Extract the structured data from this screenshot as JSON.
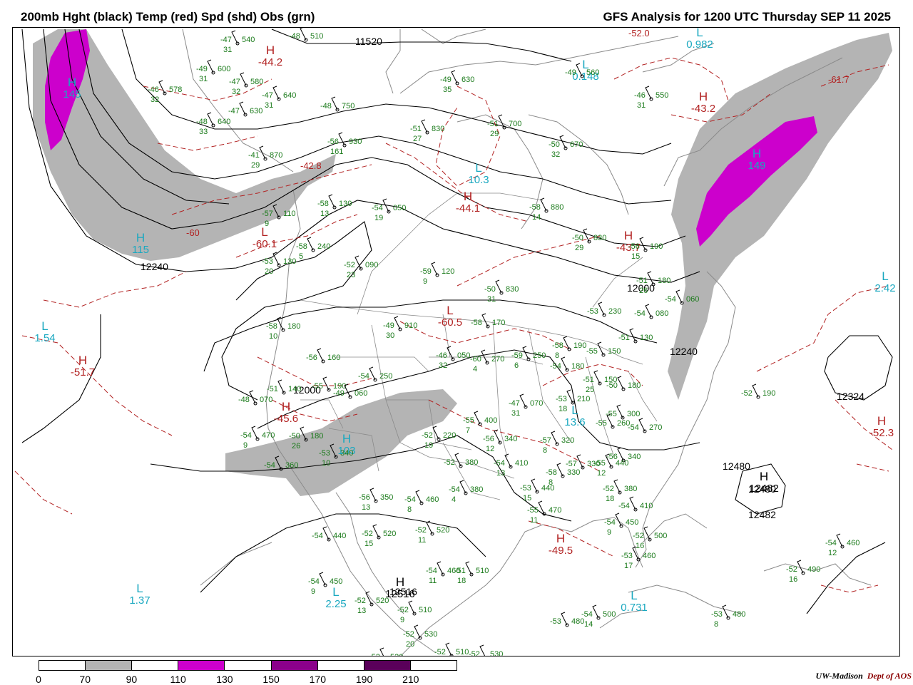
{
  "header": {
    "title_left": "200mb Hght (black) Temp (red) Spd (shd) Obs (grn)",
    "title_right": "GFS Analysis for 1200 UTC Thursday  SEP 11 2025"
  },
  "colors": {
    "height": "#000000",
    "temp": "#b22222",
    "obs": "#1a7a1a",
    "low_high": "#1aa8c0",
    "shade_70_90": "#b4b4b4",
    "shade_110_130": "#cc00cc",
    "shade_150_170": "#8b008b",
    "shade_190_210": "#5a005a"
  },
  "colorbar": {
    "labels": [
      "0",
      "70",
      "90",
      "110",
      "130",
      "150",
      "170",
      "190",
      "210"
    ],
    "segments": [
      "#ffffff",
      "#b4b4b4",
      "#ffffff",
      "#cc00cc",
      "#ffffff",
      "#8b008b",
      "#ffffff",
      "#5a005a",
      "#ffffff"
    ]
  },
  "credit": {
    "org": "UW-Madison",
    "dept": "Dept of AOS"
  },
  "height_labels": [
    "11520",
    "12240",
    "12000",
    "12240",
    "12324",
    "12480",
    "12482",
    "12480",
    "12516",
    "12000"
  ],
  "centers": [
    {
      "type": "H",
      "value": "145",
      "color": "cyan"
    },
    {
      "type": "H",
      "value": "149",
      "color": "cyan"
    },
    {
      "type": "H",
      "value": "115",
      "color": "cyan"
    },
    {
      "type": "H",
      "value": "103",
      "color": "cyan"
    },
    {
      "type": "L",
      "value": "10.3",
      "color": "cyan"
    },
    {
      "type": "L",
      "value": "0.148",
      "color": "cyan"
    },
    {
      "type": "L",
      "value": "1.54",
      "color": "cyan"
    },
    {
      "type": "L",
      "value": "2.42",
      "color": "cyan"
    },
    {
      "type": "L",
      "value": "13.6",
      "color": "cyan"
    },
    {
      "type": "L",
      "value": "1.37",
      "color": "cyan"
    },
    {
      "type": "L",
      "value": "2.25",
      "color": "cyan"
    },
    {
      "type": "L",
      "value": "0.731",
      "color": "cyan"
    },
    {
      "type": "L",
      "value": "0.982",
      "color": "cyan"
    },
    {
      "type": "H",
      "value": "-44.2",
      "color": "red"
    },
    {
      "type": "H",
      "value": "-43.2",
      "color": "red"
    },
    {
      "type": "H",
      "value": "-44.1",
      "color": "red"
    },
    {
      "type": "H",
      "value": "-43.7",
      "color": "red"
    },
    {
      "type": "H",
      "value": "-51.7",
      "color": "red"
    },
    {
      "type": "H",
      "value": "-45.6",
      "color": "red"
    },
    {
      "type": "H",
      "value": "-49.5",
      "color": "red"
    },
    {
      "type": "H",
      "value": "-52.3",
      "color": "red"
    },
    {
      "type": "L",
      "value": "-60.1",
      "color": "red"
    },
    {
      "type": "L",
      "value": "-60.5",
      "color": "red"
    },
    {
      "type": "H",
      "value": "12482",
      "color": "black"
    },
    {
      "type": "H",
      "value": "12516",
      "color": "black"
    }
  ],
  "temp_labels": [
    "-52.0",
    "-61.7",
    "-60",
    "-42.8"
  ],
  "obs": [
    {
      "t": "-47",
      "d": "31",
      "h": "540"
    },
    {
      "t": "-48",
      "d": "",
      "h": "510"
    },
    {
      "t": "-49",
      "d": "31",
      "h": "600"
    },
    {
      "t": "-47",
      "d": "32",
      "h": "580"
    },
    {
      "t": "-46",
      "d": "32",
      "h": "578"
    },
    {
      "t": "-47",
      "d": "31",
      "h": "640"
    },
    {
      "t": "-47",
      "d": "",
      "h": "630"
    },
    {
      "t": "-48",
      "d": "33",
      "h": "640"
    },
    {
      "t": "-48",
      "d": "",
      "h": "750"
    },
    {
      "t": "-49",
      "d": "35",
      "h": "630"
    },
    {
      "t": "-49",
      "d": "",
      "h": "560"
    },
    {
      "t": "-46",
      "d": "31",
      "h": "550"
    },
    {
      "t": "-51",
      "d": "27",
      "h": "830"
    },
    {
      "t": "-51",
      "d": "29",
      "h": "700"
    },
    {
      "t": "-50",
      "d": "32",
      "h": "670"
    },
    {
      "t": "-56",
      "d": "161",
      "h": "930"
    },
    {
      "t": "-41",
      "d": "29",
      "h": "870"
    },
    {
      "t": "-57",
      "d": "9",
      "h": "110"
    },
    {
      "t": "-58",
      "d": "13",
      "h": "130"
    },
    {
      "t": "-54",
      "d": "19",
      "h": "050"
    },
    {
      "t": "-58",
      "d": "14",
      "h": "880"
    },
    {
      "t": "-50",
      "d": "29",
      "h": "830"
    },
    {
      "t": "-56",
      "d": "15",
      "h": "190"
    },
    {
      "t": "-53",
      "d": "20",
      "h": "130"
    },
    {
      "t": "-58",
      "d": "5",
      "h": "240"
    },
    {
      "t": "-52",
      "d": "23",
      "h": "090"
    },
    {
      "t": "-59",
      "d": "9",
      "h": "120"
    },
    {
      "t": "-50",
      "d": "31",
      "h": "830"
    },
    {
      "t": "-49",
      "d": "30",
      "h": "910"
    },
    {
      "t": "-58",
      "d": "",
      "h": "170"
    },
    {
      "t": "-58",
      "d": "10",
      "h": "180"
    },
    {
      "t": "-51",
      "d": "26",
      "h": "180"
    },
    {
      "t": "-54",
      "d": "",
      "h": "060"
    },
    {
      "t": "-53",
      "d": "",
      "h": "230"
    },
    {
      "t": "-54",
      "d": "",
      "h": "080"
    },
    {
      "t": "-56",
      "d": "",
      "h": "160"
    },
    {
      "t": "-46",
      "d": "32",
      "h": "050"
    },
    {
      "t": "-60",
      "d": "4",
      "h": "270"
    },
    {
      "t": "-59",
      "d": "6",
      "h": "250"
    },
    {
      "t": "-58",
      "d": "8",
      "h": "190"
    },
    {
      "t": "-55",
      "d": "",
      "h": "150"
    },
    {
      "t": "-51",
      "d": "",
      "h": "130"
    },
    {
      "t": "-54",
      "d": "",
      "h": "180"
    },
    {
      "t": "-51",
      "d": "25",
      "h": "150"
    },
    {
      "t": "-50",
      "d": "",
      "h": "180"
    },
    {
      "t": "-54",
      "d": "",
      "h": "250"
    },
    {
      "t": "-55",
      "d": "",
      "h": "190"
    },
    {
      "t": "-49",
      "d": "",
      "h": "060"
    },
    {
      "t": "-51",
      "d": "",
      "h": "140"
    },
    {
      "t": "-48",
      "d": "",
      "h": "070"
    },
    {
      "t": "-47",
      "d": "31",
      "h": "070"
    },
    {
      "t": "-53",
      "d": "18",
      "h": "210"
    },
    {
      "t": "-52",
      "d": "",
      "h": "190"
    },
    {
      "t": "-54",
      "d": "9",
      "h": "470"
    },
    {
      "t": "-50",
      "d": "26",
      "h": "180"
    },
    {
      "t": "-52",
      "d": "19",
      "h": "220"
    },
    {
      "t": "-55",
      "d": "7",
      "h": "400"
    },
    {
      "t": "-56",
      "d": "12",
      "h": "340"
    },
    {
      "t": "-57",
      "d": "8",
      "h": "320"
    },
    {
      "t": "-55",
      "d": "",
      "h": "260"
    },
    {
      "t": "-55",
      "d": "",
      "h": "300"
    },
    {
      "t": "-54",
      "d": "",
      "h": "270"
    },
    {
      "t": "-54",
      "d": "",
      "h": "360"
    },
    {
      "t": "-53",
      "d": "10",
      "h": "340"
    },
    {
      "t": "-52",
      "d": "",
      "h": "380"
    },
    {
      "t": "-54",
      "d": "13",
      "h": "410"
    },
    {
      "t": "-58",
      "d": "8",
      "h": "330"
    },
    {
      "t": "-57",
      "d": "",
      "h": "330"
    },
    {
      "t": "-56",
      "d": "",
      "h": "340"
    },
    {
      "t": "-54",
      "d": "4",
      "h": "380"
    },
    {
      "t": "-53",
      "d": "15",
      "h": "440"
    },
    {
      "t": "-56",
      "d": "13",
      "h": "350"
    },
    {
      "t": "-54",
      "d": "8",
      "h": "460"
    },
    {
      "t": "-55",
      "d": "11",
      "h": "470"
    },
    {
      "t": "-52",
      "d": "18",
      "h": "380"
    },
    {
      "t": "-54",
      "d": "",
      "h": "410"
    },
    {
      "t": "-54",
      "d": "9",
      "h": "450"
    },
    {
      "t": "-54",
      "d": "",
      "h": "440"
    },
    {
      "t": "-52",
      "d": "15",
      "h": "520"
    },
    {
      "t": "-52",
      "d": "11",
      "h": "520"
    },
    {
      "t": "-52",
      "d": "16",
      "h": "500"
    },
    {
      "t": "-53",
      "d": "17",
      "h": "460"
    },
    {
      "t": "-54",
      "d": "12",
      "h": "460"
    },
    {
      "t": "-54",
      "d": "11",
      "h": "460"
    },
    {
      "t": "-51",
      "d": "18",
      "h": "510"
    },
    {
      "t": "-52",
      "d": "16",
      "h": "490"
    },
    {
      "t": "-54",
      "d": "9",
      "h": "450"
    },
    {
      "t": "-52",
      "d": "13",
      "h": "520"
    },
    {
      "t": "-52",
      "d": "9",
      "h": "510"
    },
    {
      "t": "-52",
      "d": "20",
      "h": "530"
    },
    {
      "t": "-52",
      "d": "11",
      "h": "520"
    },
    {
      "t": "-52",
      "d": "",
      "h": "510"
    },
    {
      "t": "-52",
      "d": "",
      "h": "530"
    },
    {
      "t": "-53",
      "d": "",
      "h": "480"
    },
    {
      "t": "-54",
      "d": "14",
      "h": "500"
    },
    {
      "t": "-53",
      "d": "8",
      "h": "480"
    },
    {
      "t": "-55",
      "d": "12",
      "h": "440"
    },
    {
      "t": "-54",
      "d": "9",
      "h": "340"
    }
  ]
}
